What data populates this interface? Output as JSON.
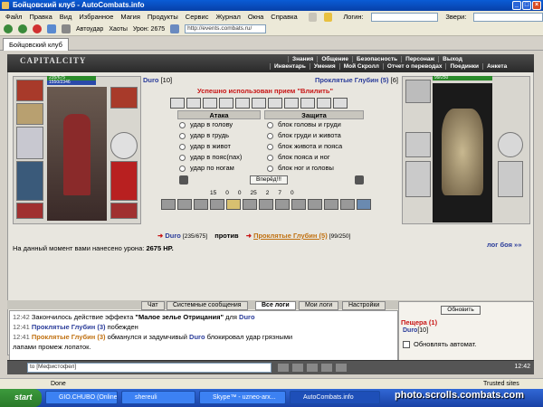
{
  "window": {
    "title": "Бойцовский клуб - AutoCombats.info"
  },
  "menu": [
    "Файл",
    "Правка",
    "Вид",
    "Избранное",
    "Магия",
    "Продукты",
    "Сервис",
    "Журнал",
    "Окна",
    "Справка"
  ],
  "toolbar": {
    "login_label": "Логин:",
    "monsters_label": "Звери:",
    "autoudar_label": "Автоудар",
    "haoty_label": "Хаоты",
    "uron_label": "Урон: 2675",
    "address": "http://events.combats.ru/"
  },
  "tab": {
    "label": "Бойцовский клуб"
  },
  "game": {
    "logo": "CAPITALCITY",
    "nav_top": [
      "Знания",
      "Общение",
      "Безопасность",
      "Персонаж",
      "Выход"
    ],
    "nav_bottom": [
      "Инвентарь",
      "Умения",
      "Мой Скролл",
      "Отчет о переводах",
      "Поединки",
      "Анкета"
    ],
    "left_hp": "235/675",
    "left_mana": "1550/2346",
    "right_hp": "99/250",
    "left_name": "Duro",
    "left_level": "[10]",
    "right_name": "Проклятые Глубин (5)",
    "right_level": "[6]",
    "success_msg": "Успешно использован прием \"Влилить\"",
    "attack_header": "Атака",
    "defense_header": "Защита",
    "attacks": [
      "удар в голову",
      "удар в грудь",
      "удар в живот",
      "удар в пояс(пах)",
      "удар по ногам"
    ],
    "defenses": [
      "блок головы и груди",
      "блок груди и живота",
      "блок живота и пояса",
      "блок пояса и ног",
      "блок ног и головы"
    ],
    "fight_button": "Вперёд!!!",
    "counters": [
      "15",
      "0",
      "0",
      "25",
      "2",
      "7",
      "0"
    ],
    "vs_left_name": "Duro",
    "vs_left_hp": "[235/675]",
    "vs_word": "против",
    "vs_right_name": "Проклятые Глубин (5)",
    "vs_right_hp": "[99/250]",
    "damage_text": "На данный момент вами нанесено урона:",
    "damage_value": "2675 HP.",
    "log_link": "лог боя »»"
  },
  "bottom_tabs": [
    "Чат",
    "Системные сообщения",
    "Все логи",
    "Мои логи",
    "Настройки"
  ],
  "log": [
    {
      "time": "12:42",
      "text": "Закончилось действие эффекта ",
      "bold": "\"Малое зелье Отрицания\"",
      "tail": " для ",
      "name": "Duro"
    },
    {
      "time": "12:41",
      "name": "Проклятые Глубин (3)",
      "text": " побежден"
    },
    {
      "time": "12:41",
      "name": "Проклятые Глубин (3)",
      "text": " обманулся и задумчивый ",
      "name2": "Duro",
      "tail": " блокировал удар грязными"
    },
    {
      "time": "",
      "text": "лапами промеж лопаток."
    }
  ],
  "side": {
    "refresh": "Обновить",
    "location": "Пещера (1)",
    "user": "Duro",
    "user_level": "[10]",
    "auto_refresh": "Обновлять автомат."
  },
  "chat": {
    "input": "to [Мефистофел]",
    "clock": "12:42"
  },
  "status": {
    "left": "Done",
    "right": "Trusted sites"
  },
  "taskbar": {
    "start": "start",
    "tasks": [
      "GIO.CHUBO (Online...",
      "shereuli",
      "Skype™ - uzneo-arx...",
      "AutoCombats.info"
    ],
    "watermark": "photo.scrolls.combats.com"
  }
}
